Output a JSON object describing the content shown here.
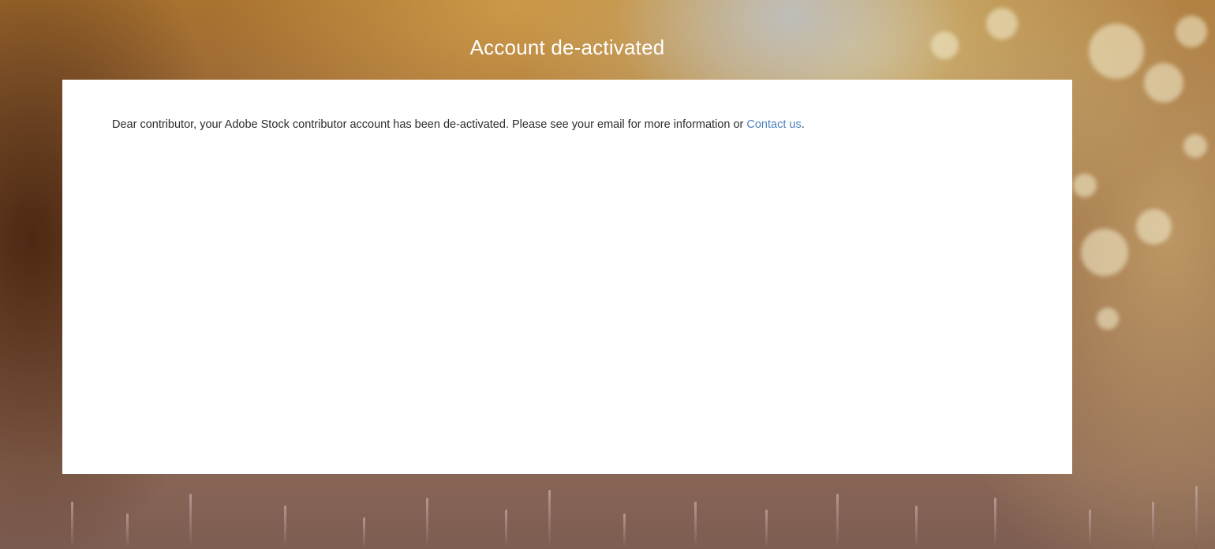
{
  "page": {
    "title": "Account de-activated"
  },
  "card": {
    "message": "Dear contributor, your Adobe Stock contributor account has been de-activated. Please see your email for more information or ",
    "link_label": "Contact us",
    "trailing_punctuation": "."
  },
  "colors": {
    "link": "#4a7fbd",
    "text": "#2c2c2c",
    "card_background": "#ffffff"
  }
}
